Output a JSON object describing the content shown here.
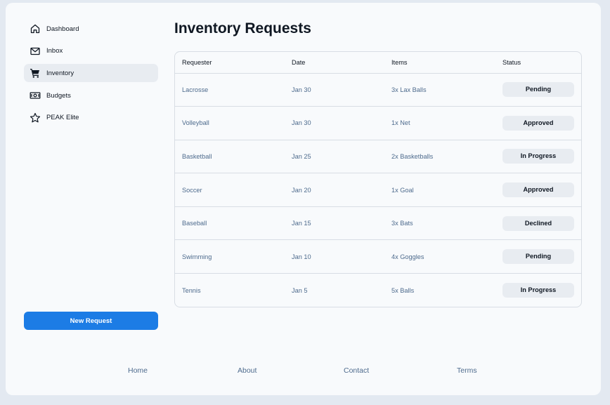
{
  "sidebar": {
    "items": [
      {
        "label": "Dashboard",
        "icon": "home-icon"
      },
      {
        "label": "Inbox",
        "icon": "mail-icon"
      },
      {
        "label": "Inventory",
        "icon": "cart-icon",
        "active": true
      },
      {
        "label": "Budgets",
        "icon": "money-icon"
      },
      {
        "label": "PEAK Elite",
        "icon": "star-icon"
      }
    ],
    "new_request_label": "New Request"
  },
  "main": {
    "title": "Inventory Requests",
    "columns": [
      "Requester",
      "Date",
      "Items",
      "Status"
    ],
    "rows": [
      {
        "requester": "Lacrosse",
        "date": "Jan 30",
        "items": "3x Lax Balls",
        "status": "Pending"
      },
      {
        "requester": "Volleyball",
        "date": "Jan 30",
        "items": "1x Net",
        "status": "Approved"
      },
      {
        "requester": "Basketball",
        "date": "Jan 25",
        "items": "2x Basketballs",
        "status": "In Progress"
      },
      {
        "requester": "Soccer",
        "date": "Jan 20",
        "items": "1x Goal",
        "status": "Approved"
      },
      {
        "requester": "Baseball",
        "date": "Jan 15",
        "items": "3x Bats",
        "status": "Declined"
      },
      {
        "requester": "Swimming",
        "date": "Jan 10",
        "items": "4x Goggles",
        "status": "Pending"
      },
      {
        "requester": "Tennis",
        "date": "Jan 5",
        "items": "5x Balls",
        "status": "In Progress"
      }
    ]
  },
  "footer": {
    "links": [
      "Home",
      "About",
      "Contact",
      "Terms"
    ]
  },
  "colors": {
    "accent": "#1c7ce5",
    "muted_text": "#4e6b8d",
    "active_bg": "#e8ecf1"
  }
}
